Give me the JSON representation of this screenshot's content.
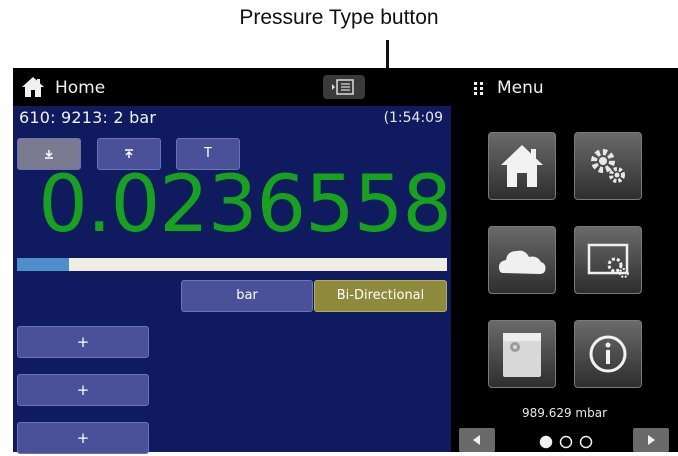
{
  "callout": {
    "text": "Pressure Type button"
  },
  "header": {
    "title": "Home",
    "menu_title": "Menu"
  },
  "channel": {
    "info": "610: 9213:  2 bar",
    "clock": "(1:54:09"
  },
  "buttons": {
    "tare_label": "T",
    "unit_label": "bar",
    "pressure_type_label": "Bi-Directional",
    "plus_label": "+"
  },
  "reading": {
    "value": "0.0236558"
  },
  "progress": {
    "fraction": 0.12
  },
  "barometer": {
    "text": "989.629 mbar"
  },
  "pager": {
    "pages": 3,
    "current": 1
  },
  "menu_tiles": [
    "home-icon",
    "settings-icon",
    "cloud-icon",
    "display-settings-icon",
    "calibration-icon",
    "info-icon"
  ]
}
